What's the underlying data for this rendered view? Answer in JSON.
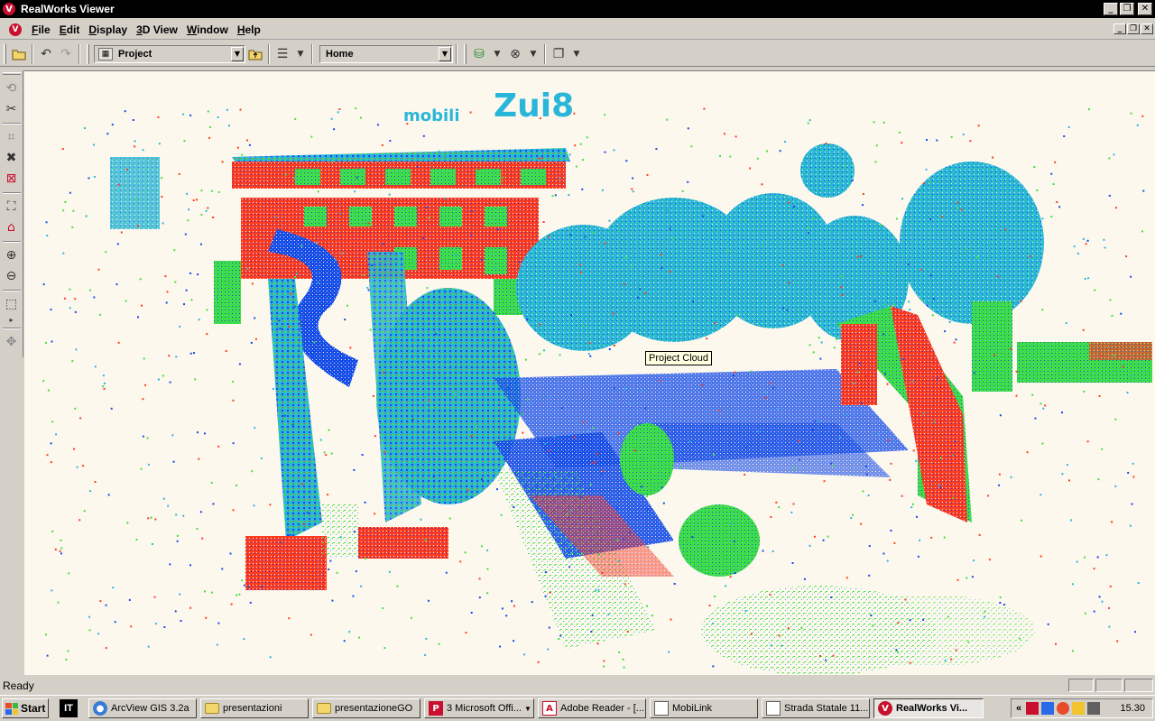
{
  "window": {
    "title": "RealWorks Viewer"
  },
  "menu": [
    "File",
    "Edit",
    "Display",
    "3D View",
    "Window",
    "Help"
  ],
  "toolbar": {
    "project_combo": "Project",
    "view_combo": "Home"
  },
  "viewport": {
    "tooltip": "Project Cloud",
    "sign_text": "Zui8",
    "sign_small": "mobili",
    "colors": {
      "background": "#fdf8ee",
      "red": "#ff3b1f",
      "green": "#40e040",
      "blue": "#1848e8",
      "cyan": "#2ab6d8"
    }
  },
  "status": {
    "text": "Ready"
  },
  "taskbar": {
    "start": "Start",
    "lang": "IT",
    "buttons": [
      {
        "label": "ArcView GIS 3.2a",
        "icon": "globe-icon"
      },
      {
        "label": "presentazioni",
        "icon": "folder-icon"
      },
      {
        "label": "presentazioneGO",
        "icon": "folder-icon"
      },
      {
        "label": "3 Microsoft Offi...",
        "icon": "office-icon"
      },
      {
        "label": "Adobe Reader - [...",
        "icon": "pdf-icon"
      },
      {
        "label": "MobiLink",
        "icon": "document-icon"
      },
      {
        "label": "Strada Statale 11...",
        "icon": "document-icon"
      },
      {
        "label": "RealWorks Vi...",
        "icon": "realworks-icon"
      }
    ],
    "clock": "15.30"
  }
}
